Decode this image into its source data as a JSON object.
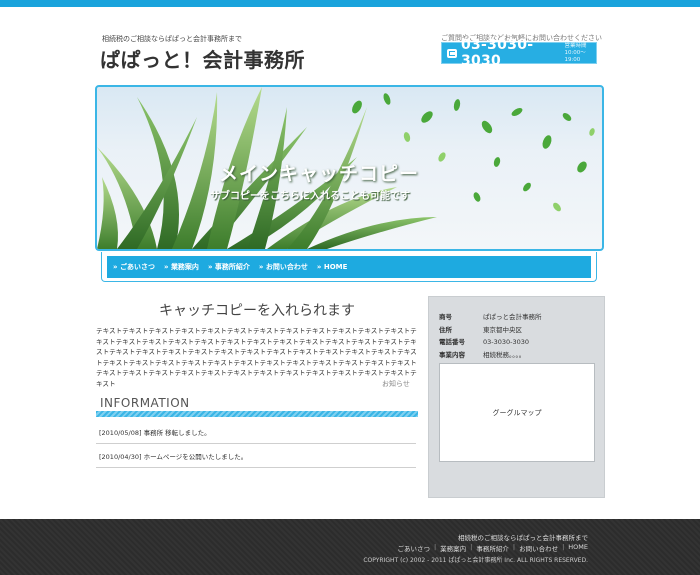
{
  "header": {
    "tagline": "相続税のご相談ならぱぱっと会計事務所まで",
    "logo": "ぱぱっと！会計事務所",
    "contact_note": "ご質問やご相談などお気軽にお問い合わせください",
    "phone": "03-3030-3030",
    "hours_label": "営業時間",
    "hours": "10:00～19:00"
  },
  "hero": {
    "main_copy": "メインキャッチコピー",
    "sub_copy": "サブコピーをこちらに入れることも可能です"
  },
  "nav": {
    "items": [
      "ごあいさつ",
      "業務案内",
      "事務所紹介",
      "お問い合わせ",
      "HOME"
    ]
  },
  "main": {
    "catch_copy": "キャッチコピーを入れられます",
    "body_text": "テキストテキストテキストテキストテキストテキストテキストテキストテキストテキストテキストテキストテキストテキストテキストテキストテキストテキストテキストテキストテキストテキストテキストテキストテキストテキストテキストテキストテキストテキストテキストテキストテキストテキストテキストテキストテキストテキストテキストテキストテキストテキストテキストテキストテキストテキストテキストテキストテキストテキストテキストテキストテキストテキストテキストテキストテキストテキストテキストテキストテキストテキスト",
    "notice_link": "お知らせ",
    "info_title": "INFORMATION",
    "news": [
      {
        "text": "[2010/05/08] 事務所 移転しました。"
      },
      {
        "text": "[2010/04/30] ホームページを公開いたしました。"
      }
    ]
  },
  "side": {
    "rows": [
      {
        "key": "商号",
        "value": "ぱぱっと会計事務所"
      },
      {
        "key": "住所",
        "value": "東京都中央区"
      },
      {
        "key": "電話番号",
        "value": "03-3030-3030"
      },
      {
        "key": "事業内容",
        "value": "相続税務。。。。"
      }
    ],
    "map_label": "グーグルマップ"
  },
  "footer": {
    "tagline": "相続税のご相談ならぱぱっと会計事務所まで",
    "nav": [
      "ごあいさつ",
      "業務案内",
      "事務所紹介",
      "お問い合わせ",
      "HOME"
    ],
    "copyright": "COPYRIGHT (c) 2002 - 2011 ぱぱっと会計事務所 Inc. ALL RIGHTS RESERVED."
  },
  "colors": {
    "accent": "#1eaae0",
    "footer_bg": "#2c2c2c",
    "sidebar_bg": "#d9dcdf"
  }
}
